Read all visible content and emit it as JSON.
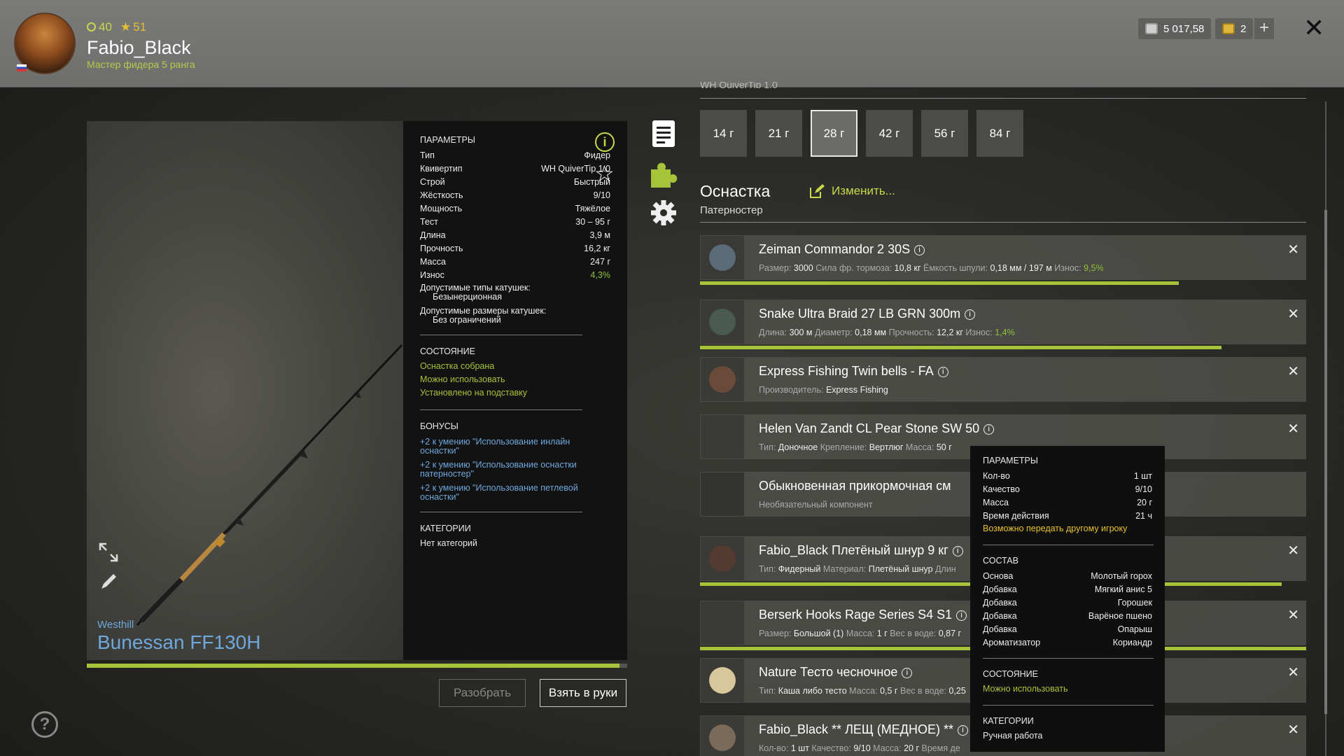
{
  "header": {
    "level": "40",
    "stars": "51",
    "username": "Fabio_Black",
    "rank": "Мастер фидера 5 ранга",
    "money": "5 017,58",
    "gold": "2",
    "plus": "+",
    "close": "✕"
  },
  "rod": {
    "brand": "Westhill",
    "name": "Bunessan FF130H",
    "wear_fraction": 0.986
  },
  "params": {
    "title": "ПАРАМЕТРЫ",
    "rows": [
      {
        "label": "Тип",
        "value": "Фидер"
      },
      {
        "label": "Квивертип",
        "value": "WH QuiverTip 1.0"
      },
      {
        "label": "Строй",
        "value": "Быстрый"
      },
      {
        "label": "Жёсткость",
        "value": "9/10"
      },
      {
        "label": "Мощность",
        "value": "Тяжёлое"
      },
      {
        "label": "Тест",
        "value": "30 – 95 г"
      },
      {
        "label": "Длина",
        "value": "3,9 м"
      },
      {
        "label": "Прочность",
        "value": "16,2 кг"
      },
      {
        "label": "Масса",
        "value": "247 г"
      },
      {
        "label": "Износ",
        "value": "4,3%"
      }
    ],
    "reel_types_label": "Допустимые типы катушек:",
    "reel_types_value": "Безынерционная",
    "reel_sizes_label": "Допустимые размеры катушек:",
    "reel_sizes_value": "Без ограничений",
    "state_title": "СОСТОЯНИЕ",
    "state": [
      "Оснастка собрана",
      "Можно использовать",
      "Установлено на подставку"
    ],
    "bonus_title": "БОНУСЫ",
    "bonuses": [
      "+2 к умению \"Использование инлайн оснастки\"",
      "+2 к умению \"Использование оснастки патерностер\"",
      "+2 к умению \"Использование петлевой оснастки\""
    ],
    "cat_title": "КАТЕГОРИИ",
    "cat_value": "Нет категорий"
  },
  "buttons": {
    "disassemble": "Разобрать",
    "take": "Взять в руки",
    "help": "?"
  },
  "tackle": {
    "cut_label": "WH QuiverTip 1.0",
    "weights": [
      "14 г",
      "21 г",
      "28 г",
      "42 г",
      "56 г",
      "84 г"
    ],
    "selected_weight": "28 г",
    "title": "Оснастка",
    "subtitle": "Патерностер",
    "edit": "Изменить..."
  },
  "items": [
    {
      "title": "Zeiman Commandor 2 30S",
      "meta": [
        [
          "Размер:",
          "3000"
        ],
        [
          "Сила фр. тормоза:",
          "10,8 кг"
        ],
        [
          "Ёмкость шпули:",
          "0,18 мм / 197 м"
        ],
        [
          "Износ:",
          "9,5%"
        ]
      ],
      "bar": 0.79
    },
    {
      "title": "Snake Ultra Braid 27 LB GRN 300m",
      "meta": [
        [
          "Длина:",
          "300 м"
        ],
        [
          "Диаметр:",
          "0,18 мм"
        ],
        [
          "Прочность:",
          "12,2 кг"
        ],
        [
          "Износ:",
          "1,4%"
        ]
      ],
      "bar": 0.86
    },
    {
      "title": "Express Fishing Twin bells - FA",
      "meta": [
        [
          "Производитель:",
          "Express Fishing"
        ]
      ]
    },
    {
      "title": "Helen Van Zandt CL Pear Stone SW 50",
      "meta": [
        [
          "Тип:",
          "Доночное"
        ],
        [
          "Крепление:",
          "Вертлюг"
        ],
        [
          "Масса:",
          "50 г"
        ]
      ]
    },
    {
      "title": "Обыкновенная прикормочная см",
      "meta": [
        [
          "Необязательный компонент",
          ""
        ]
      ]
    },
    {
      "title": "Fabio_Black Плетёный шнур 9 кг",
      "meta": [
        [
          "Тип:",
          "Фидерный"
        ],
        [
          "Материал:",
          "Плетёный шнур"
        ],
        [
          "Длин",
          ""
        ]
      ],
      "bar": 0.96
    },
    {
      "title": "Berserk Hooks Rage Series S4 S1",
      "meta": [
        [
          "Размер:",
          "Большой (1)"
        ],
        [
          "Масса:",
          "1 г"
        ],
        [
          "Вес в воде:",
          "0,87 г"
        ]
      ],
      "bar": 1.0
    },
    {
      "title": "Nature Тесто чесночное",
      "meta": [
        [
          "Тип:",
          "Каша либо тесто"
        ],
        [
          "Масса:",
          "0,5 г"
        ],
        [
          "Вес в воде:",
          "0,25"
        ]
      ]
    },
    {
      "title": "Fabio_Black ** ЛЕЩ (МЕДНОЕ) **",
      "meta": [
        [
          "Кол-во:",
          "1 шт"
        ],
        [
          "Качество:",
          "9/10"
        ],
        [
          "Масса:",
          "20 г"
        ],
        [
          "Время де",
          ""
        ]
      ]
    }
  ],
  "tooltip": {
    "title": "ПАРАМЕТРЫ",
    "rows": [
      {
        "label": "Кол-во",
        "value": "1 шт"
      },
      {
        "label": "Качество",
        "value": "9/10"
      },
      {
        "label": "Масса",
        "value": "20 г"
      },
      {
        "label": "Время действия",
        "value": "21 ч"
      }
    ],
    "transfer": "Возможно передать другому игроку",
    "comp_title": "СОСТАВ",
    "comp": [
      {
        "label": "Основа",
        "value": "Молотый горох"
      },
      {
        "label": "Добавка",
        "value": "Мягкий анис 5"
      },
      {
        "label": "Добавка",
        "value": "Горошек"
      },
      {
        "label": "Добавка",
        "value": "Варёное пшено"
      },
      {
        "label": "Добавка",
        "value": "Опарыш"
      },
      {
        "label": "Ароматизатор",
        "value": "Кориандр"
      }
    ],
    "state_title": "СОСТОЯНИЕ",
    "state": "Можно использовать",
    "cat_title": "КАТЕГОРИИ",
    "cat": "Ручная работа"
  },
  "colors": {
    "accent_green": "#a7c33a",
    "link_blue": "#6fa8dc",
    "yellow": "#e6c032"
  }
}
